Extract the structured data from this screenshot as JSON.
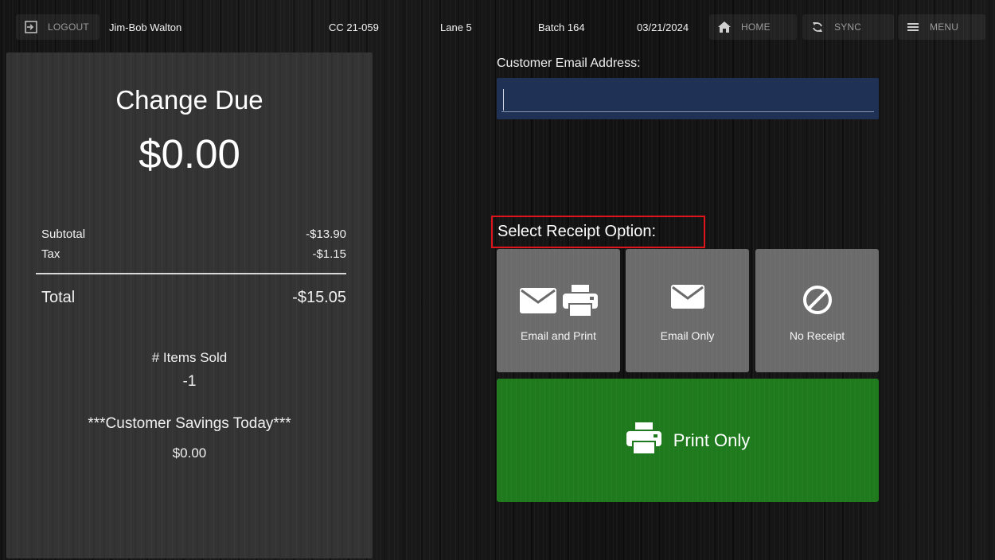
{
  "topbar": {
    "logout_label": "LOGOUT",
    "user_name": "Jim-Bob Walton",
    "terminal": "CC 21-059",
    "lane": "Lane 5",
    "batch": "Batch 164",
    "date": "03/21/2024",
    "home_label": "HOME",
    "sync_label": "SYNC",
    "menu_label": "MENU"
  },
  "summary": {
    "change_title": "Change Due",
    "change_amount": "$0.00",
    "subtotal_label": "Subtotal",
    "subtotal_value": "-$13.90",
    "tax_label": "Tax",
    "tax_value": "-$1.15",
    "total_label": "Total",
    "total_value": "-$15.05",
    "items_sold_label": "# Items Sold",
    "items_sold_value": "-1",
    "savings_label": "***Customer Savings Today***",
    "savings_value": "$0.00"
  },
  "email": {
    "label": "Customer Email Address:",
    "value": "",
    "placeholder": ""
  },
  "receipt": {
    "heading": "Select Receipt Option:",
    "options": [
      {
        "label": "Email and Print",
        "icons": [
          "envelope-icon",
          "printer-icon"
        ]
      },
      {
        "label": "Email Only",
        "icons": [
          "envelope-icon"
        ]
      },
      {
        "label": "No Receipt",
        "icons": [
          "prohibited-icon"
        ]
      }
    ],
    "print_only_label": "Print Only"
  },
  "colors": {
    "highlight_border": "#e0141b",
    "print_only_bg": "#1e7a1c",
    "email_input_bg": "#1f3154",
    "option_bg": "#6b6b6b"
  }
}
